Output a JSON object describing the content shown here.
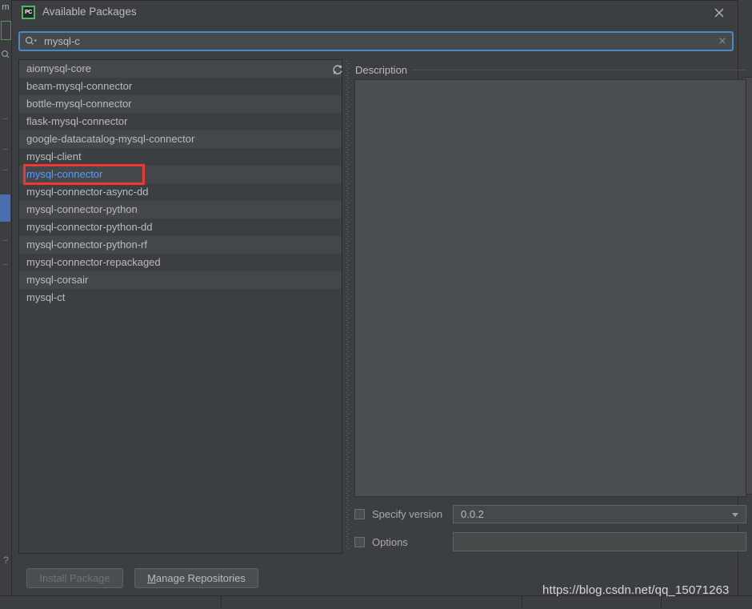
{
  "window": {
    "title": "Available Packages",
    "app_icon_label": "PC",
    "close_icon": "close-icon",
    "accent_color": "#4a88c7",
    "annotation_color": "#f53434",
    "link_color": "#589df6"
  },
  "search": {
    "value": "mysql-c",
    "placeholder": "",
    "search_icon": "search-icon",
    "clear_icon": "clear-icon"
  },
  "package_list": {
    "refresh_icon": "refresh-icon",
    "selected": "mysql-connector",
    "items": [
      "aiomysql-core",
      "beam-mysql-connector",
      "bottle-mysql-connector",
      "flask-mysql-connector",
      "google-datacatalog-mysql-connector",
      "mysql-client",
      "mysql-connector",
      "mysql-connector-async-dd",
      "mysql-connector-python",
      "mysql-connector-python-dd",
      "mysql-connector-python-rf",
      "mysql-connector-repackaged",
      "mysql-corsair",
      "mysql-ct"
    ]
  },
  "description": {
    "label": "Description",
    "content": ""
  },
  "options": {
    "specify_version": {
      "label": "Specify version",
      "checked": false,
      "value": "0.0.2",
      "dropdown_icon": "chevron-down-icon"
    },
    "options_row": {
      "label": "Options",
      "checked": false,
      "value": ""
    }
  },
  "footer": {
    "install_label": "Install Package",
    "install_enabled": false,
    "manage_mnemonic": "M",
    "manage_label_rest": "anage Repositories"
  },
  "watermark": {
    "text": "https://blog.csdn.net/qq_15071263"
  },
  "background": {
    "strip_text": "m",
    "help_icon": "help-icon",
    "magnifier_icon": "search-icon",
    "expand_icon": "chevron-right-icon"
  }
}
